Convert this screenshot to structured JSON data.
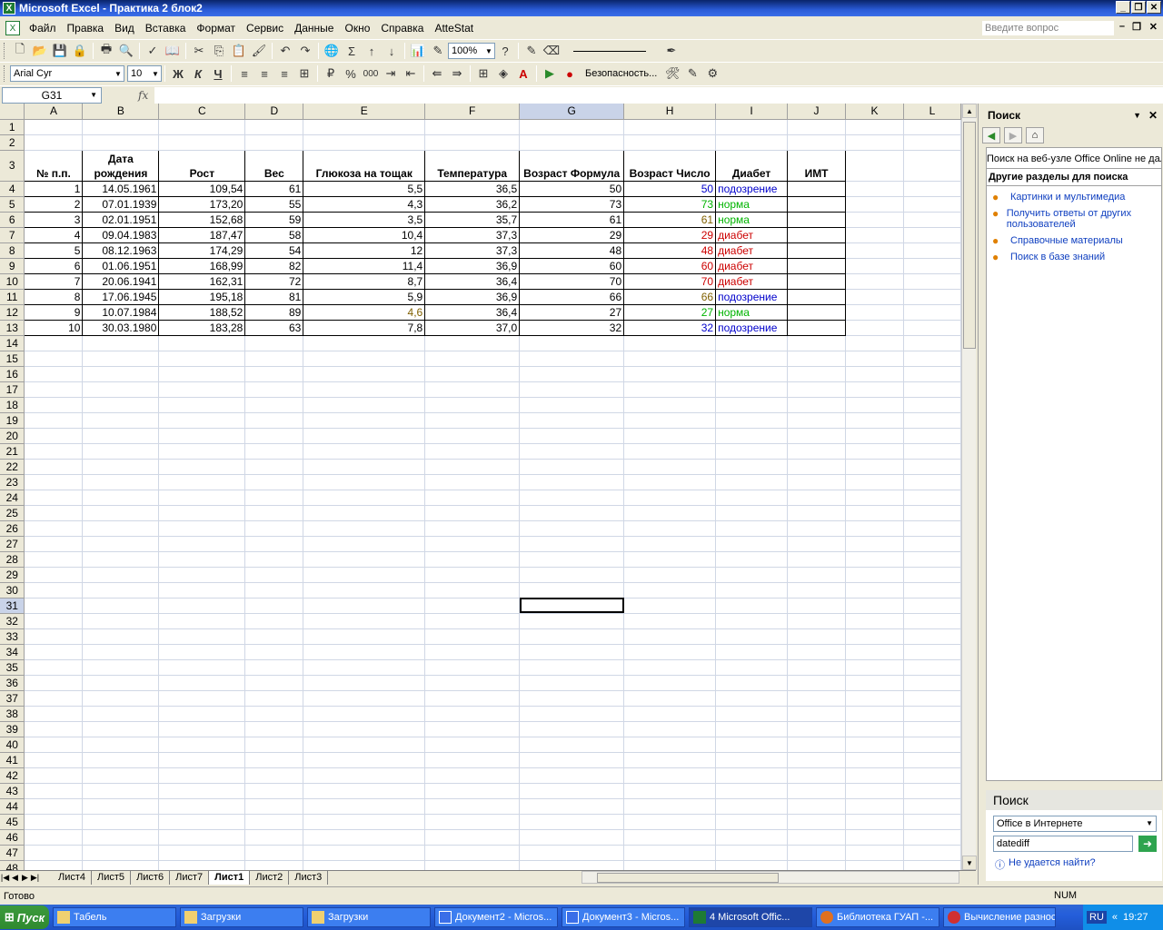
{
  "window": {
    "title": "Microsoft Excel - Практика 2 блок2"
  },
  "menu": {
    "items": [
      "Файл",
      "Правка",
      "Вид",
      "Вставка",
      "Формат",
      "Сервис",
      "Данные",
      "Окно",
      "Справка",
      "AtteStat"
    ],
    "ask_placeholder": "Введите вопрос"
  },
  "toolbar": {
    "zoom": "100%",
    "font": "Arial Cyr",
    "size": "10",
    "bold": "Ж",
    "italic": "К",
    "underline": "Ч",
    "security": "Безопасность...",
    "percent": "%",
    "thousands": "000"
  },
  "formula": {
    "namebox": "G31",
    "fx": "fx",
    "content": ""
  },
  "sheet": {
    "columns": [
      "A",
      "B",
      "C",
      "D",
      "E",
      "F",
      "G",
      "H",
      "I",
      "J",
      "K",
      "L"
    ],
    "selected_col": "G",
    "selected_row": 31,
    "headers": {
      "a": "№ п.п.",
      "b": "Дата рождения",
      "c": "Рост",
      "d": "Вес",
      "e": "Глюкоза на тощак",
      "f": "Температура",
      "g": "Возраст Формула",
      "h": "Возраст Число",
      "i": "Диабет",
      "j": "ИМТ"
    },
    "rows": [
      {
        "a": "1",
        "b": "14.05.1961",
        "c": "109,54",
        "d": "61",
        "e": "5,5",
        "f": "36,5",
        "g": "50",
        "h": "50",
        "i": "подозрение",
        "j": ""
      },
      {
        "a": "2",
        "b": "07.01.1939",
        "c": "173,20",
        "d": "55",
        "e": "4,3",
        "f": "36,2",
        "g": "73",
        "h": "73",
        "i": "норма",
        "j": ""
      },
      {
        "a": "3",
        "b": "02.01.1951",
        "c": "152,68",
        "d": "59",
        "e": "3,5",
        "f": "35,7",
        "g": "61",
        "h": "61",
        "i": "норма",
        "j": ""
      },
      {
        "a": "4",
        "b": "09.04.1983",
        "c": "187,47",
        "d": "58",
        "e": "10,4",
        "f": "37,3",
        "g": "29",
        "h": "29",
        "i": "диабет",
        "j": ""
      },
      {
        "a": "5",
        "b": "08.12.1963",
        "c": "174,29",
        "d": "54",
        "e": "12",
        "f": "37,3",
        "g": "48",
        "h": "48",
        "i": "диабет",
        "j": ""
      },
      {
        "a": "6",
        "b": "01.06.1951",
        "c": "168,99",
        "d": "82",
        "e": "11,4",
        "f": "36,9",
        "g": "60",
        "h": "60",
        "i": "диабет",
        "j": ""
      },
      {
        "a": "7",
        "b": "20.06.1941",
        "c": "162,31",
        "d": "72",
        "e": "8,7",
        "f": "36,4",
        "g": "70",
        "h": "70",
        "i": "диабет",
        "j": ""
      },
      {
        "a": "8",
        "b": "17.06.1945",
        "c": "195,18",
        "d": "81",
        "e": "5,9",
        "f": "36,9",
        "g": "66",
        "h": "66",
        "i": "подозрение",
        "j": ""
      },
      {
        "a": "9",
        "b": "10.07.1984",
        "c": "188,52",
        "d": "89",
        "e": "4,6",
        "f": "36,4",
        "g": "27",
        "h": "27",
        "i": "норма",
        "j": ""
      },
      {
        "a": "10",
        "b": "30.03.1980",
        "c": "183,28",
        "d": "63",
        "e": "7,8",
        "f": "37,0",
        "g": "32",
        "h": "32",
        "i": "подозрение",
        "j": ""
      }
    ],
    "tabs": [
      "Лист4",
      "Лист5",
      "Лист6",
      "Лист7",
      "Лист1",
      "Лист2",
      "Лист3"
    ],
    "active_tab": "Лист1"
  },
  "taskpane": {
    "title": "Поиск",
    "message": "Поиск на веб-узле Office Online не дал",
    "section": "Другие разделы для поиска",
    "links": [
      "Картинки и мультимедиа",
      "Получить ответы от других пользователей",
      "Справочные материалы",
      "Поиск в базе знаний"
    ],
    "search_title": "Поиск",
    "scope": "Office в Интернете",
    "query": "datediff",
    "help": "Не удается найти?"
  },
  "status": {
    "ready": "Готово",
    "num": "NUM"
  },
  "taskbar": {
    "start": "Пуск",
    "tasks": [
      "Табель",
      "Загрузки",
      "Загрузки",
      "Документ2 - Micros...",
      "Документ3 - Micros...",
      "4 Microsoft Offic...",
      "Библиотека ГУАП -...",
      "Вычисление разнос..."
    ],
    "lang": "RU",
    "time": "19:27"
  }
}
